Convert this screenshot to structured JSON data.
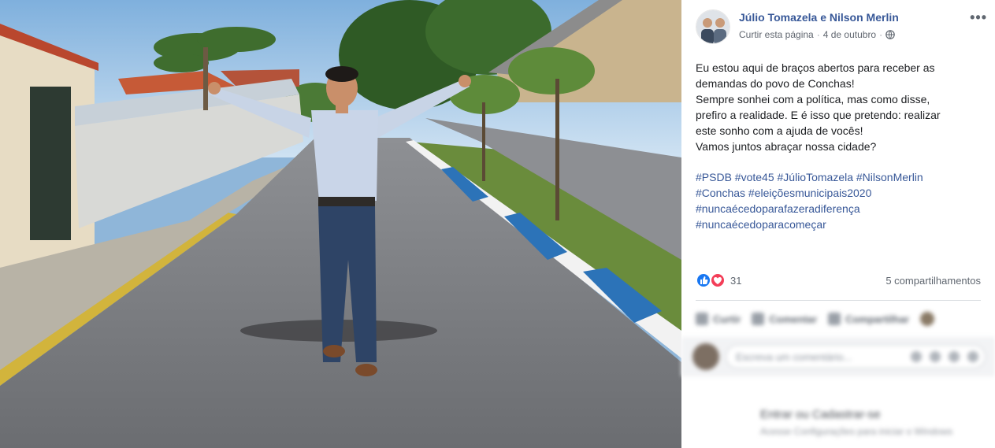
{
  "photo": {
    "description_icon": "photo-icon"
  },
  "post": {
    "page_name": "Júlio Tomazela e Nilson Merlin",
    "like_page": "Curtir esta página",
    "separator": "·",
    "date": "4 de outubro",
    "more": "•••",
    "text_lines": [
      "Eu estou aqui de braços abertos para receber as",
      "demandas do povo de Conchas!",
      "Sempre sonhei com a política, mas como disse,",
      "prefiro a realidade. E é isso que pretendo: realizar",
      "este sonho com a ajuda de vocês!",
      "Vamos juntos abraçar nossa cidade?"
    ],
    "hashtag_lines": [
      "#PSDB #vote45 #JúlioTomazela #NilsonMerlin",
      "#Conchas #eleiçõesmunicipais2020",
      "#nuncaécedoparafazeradiferença",
      "#nuncaécedoparacomeçar"
    ],
    "reaction_count": "31",
    "shares": "5 compartilhamentos"
  },
  "actions": {
    "like": "Curtir",
    "comment": "Comentar",
    "share": "Compartilhar"
  },
  "comment": {
    "placeholder": "Escreva um comentário..."
  },
  "footer": {
    "line1": "Entrar ou Cadastrar-se",
    "line2": "Acesse Configurações para iniciar o Windows"
  },
  "colors": {
    "link": "#385898",
    "text": "#1c1e21",
    "muted": "#606770",
    "like": "#1877f2",
    "love": "#f33e58"
  }
}
